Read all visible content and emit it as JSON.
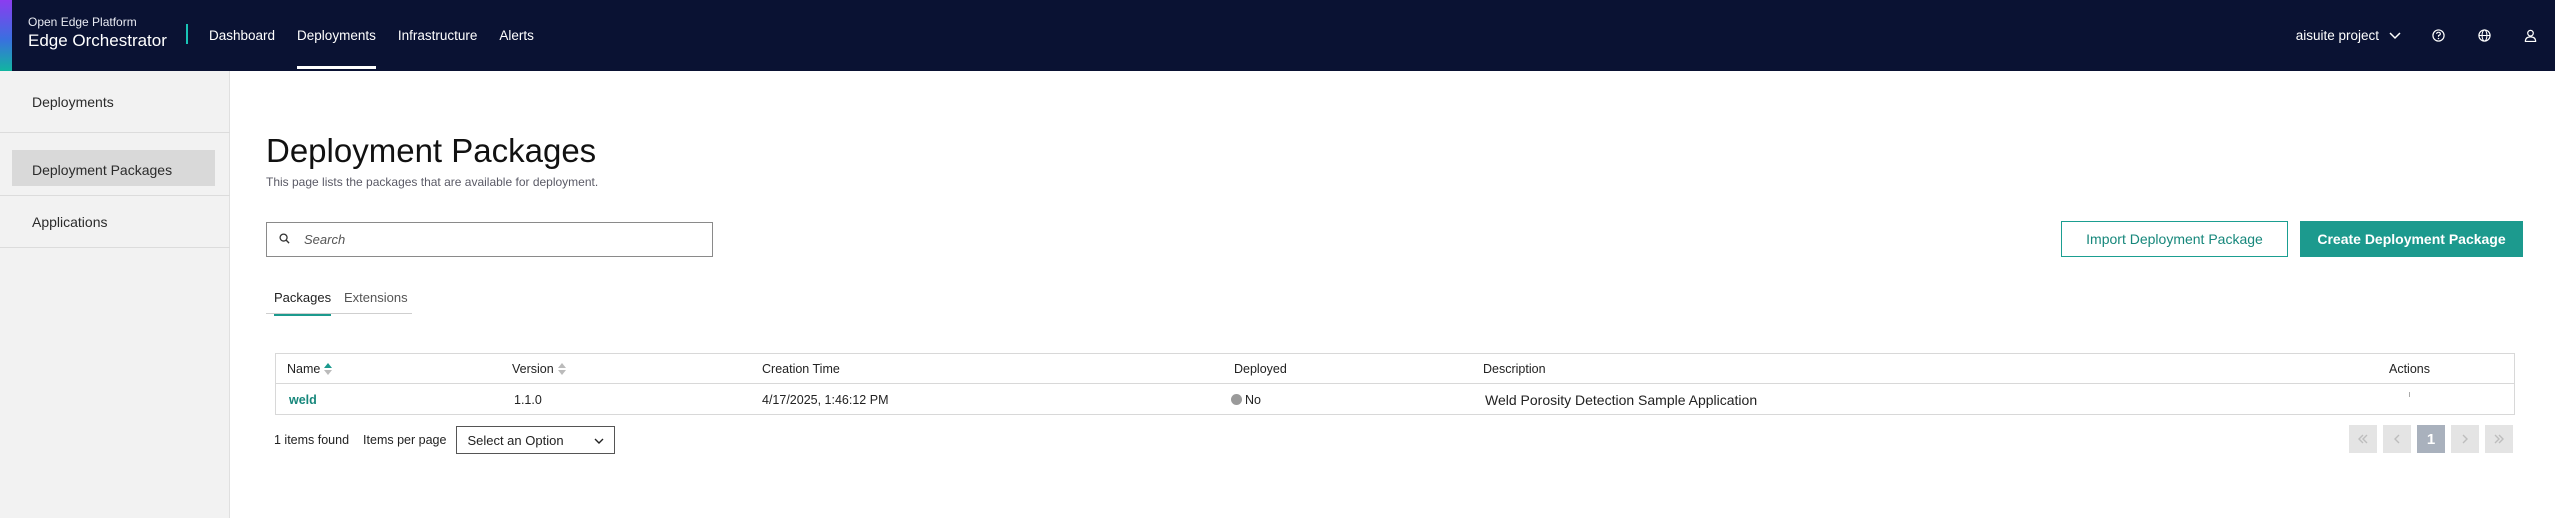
{
  "header": {
    "brand_line1": "Open Edge Platform",
    "brand_line2": "Edge Orchestrator",
    "nav": [
      {
        "label": "Dashboard"
      },
      {
        "label": "Deployments"
      },
      {
        "label": "Infrastructure"
      },
      {
        "label": "Alerts"
      }
    ],
    "active_nav": "Deployments",
    "project": "aisuite project",
    "icons": [
      "help-icon",
      "globe-icon",
      "user-icon"
    ]
  },
  "sidebar": {
    "items": [
      {
        "label": "Deployments"
      },
      {
        "label": "Deployment Packages"
      },
      {
        "label": "Applications"
      }
    ],
    "active": "Deployment Packages"
  },
  "main": {
    "title": "Deployment Packages",
    "subtitle": "This page lists the packages that are available for deployment.",
    "search": {
      "placeholder": "Search",
      "value": ""
    },
    "import_button": "Import Deployment Package",
    "create_button": "Create Deployment Package",
    "tabs": [
      {
        "label": "Packages"
      },
      {
        "label": "Extensions"
      }
    ],
    "active_tab": "Packages"
  },
  "table": {
    "columns": [
      {
        "label": "Name",
        "sortable": true,
        "sort": "asc"
      },
      {
        "label": "Version",
        "sortable": true
      },
      {
        "label": "Creation Time"
      },
      {
        "label": "Deployed"
      },
      {
        "label": "Description"
      },
      {
        "label": "Actions"
      }
    ],
    "rows": [
      {
        "name": "weld",
        "version": "1.1.0",
        "creation_time": "4/17/2025, 1:46:12 PM",
        "deployed": "No",
        "description": "Weld Porosity Detection Sample Application"
      }
    ]
  },
  "footer": {
    "count": "1 items found",
    "items_per_page_label": "Items per page",
    "select_value": "Select an Option",
    "current_page": "1"
  },
  "colors": {
    "header_bg": "#0a1233",
    "accent_teal": "#1c9a8e",
    "sidebar_bg": "#f2f2f2"
  }
}
